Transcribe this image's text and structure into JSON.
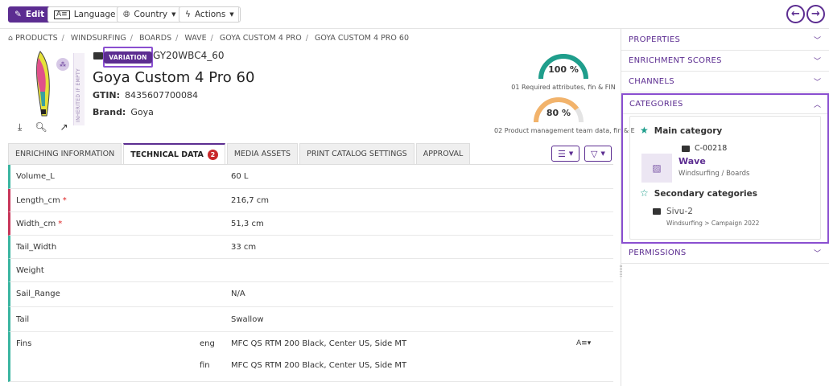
{
  "toolbar": {
    "edit_label": "Edit",
    "language_label": "Language",
    "country_label": "Country",
    "actions_label": "Actions",
    "prev_icon": "arrow-left-circle-icon",
    "next_icon": "arrow-right-circle-icon"
  },
  "breadcrumb": [
    "PRODUCTS",
    "WINDSURFING",
    "BOARDS",
    "WAVE",
    "GOYA CUSTOM 4 PRO",
    "GOYA CUSTOM 4 PRO 60"
  ],
  "product": {
    "badge": "VARIATION",
    "sku": "GY20WBC4_60",
    "title": "Goya Custom 4 Pro 60",
    "gtin_label": "GTIN:",
    "gtin": "8435607700084",
    "brand_label": "Brand:",
    "brand": "Goya",
    "inherited_label": "INHERITED IF EMPTY"
  },
  "scores": [
    {
      "percent": "100 %",
      "value": 100,
      "caption": "01 Required attributes, fin & FIN",
      "color": "#1f9e8c"
    },
    {
      "percent": "80 %",
      "value": 80,
      "caption": "02 Product management team data, fin & E",
      "color": "#f2b36b"
    }
  ],
  "tabs": [
    {
      "label": "ENRICHING INFORMATION",
      "active": false
    },
    {
      "label": "TECHNICAL DATA",
      "active": true,
      "badge": "2"
    },
    {
      "label": "MEDIA ASSETS",
      "active": false
    },
    {
      "label": "PRINT CATALOG SETTINGS",
      "active": false
    },
    {
      "label": "APPROVAL",
      "active": false
    }
  ],
  "attributes": [
    {
      "name": "Volume_L",
      "value": "60 L",
      "required": false
    },
    {
      "name": "Length_cm",
      "value": "216,7 cm",
      "required": true
    },
    {
      "name": "Width_cm",
      "value": "51,3 cm",
      "required": true
    },
    {
      "name": "Tail_Width",
      "value": "33 cm",
      "required": false
    },
    {
      "name": "Weight",
      "value": "",
      "required": false
    },
    {
      "name": "Sail_Range",
      "value": "N/A",
      "required": false
    },
    {
      "name": "Tail",
      "value": "Swallow",
      "required": false
    },
    {
      "name": "Fins",
      "required": false,
      "localized": [
        {
          "lang": "eng",
          "value": "MFC QS RTM 200 Black, Center US, Side MT"
        },
        {
          "lang": "fin",
          "value": "MFC QS RTM 200 Black, Center US, Side MT"
        }
      ]
    }
  ],
  "side": {
    "properties": "PROPERTIES",
    "enrichment_scores": "ENRICHMENT SCORES",
    "channels": "CHANNELS",
    "categories": "CATEGORIES",
    "permissions": "PERMISSIONS",
    "main_category_label": "Main category",
    "main_category_code": "C-00218",
    "main_category_name": "Wave",
    "main_category_path": "Windsurfing / Boards",
    "secondary_label": "Secondary categories",
    "secondary_name": "Sivu-2",
    "secondary_path": "Windsurfing > Campaign 2022"
  },
  "colors": {
    "accent": "#5c2d91",
    "teal": "#1f9e8c",
    "required": "#c8365a"
  }
}
